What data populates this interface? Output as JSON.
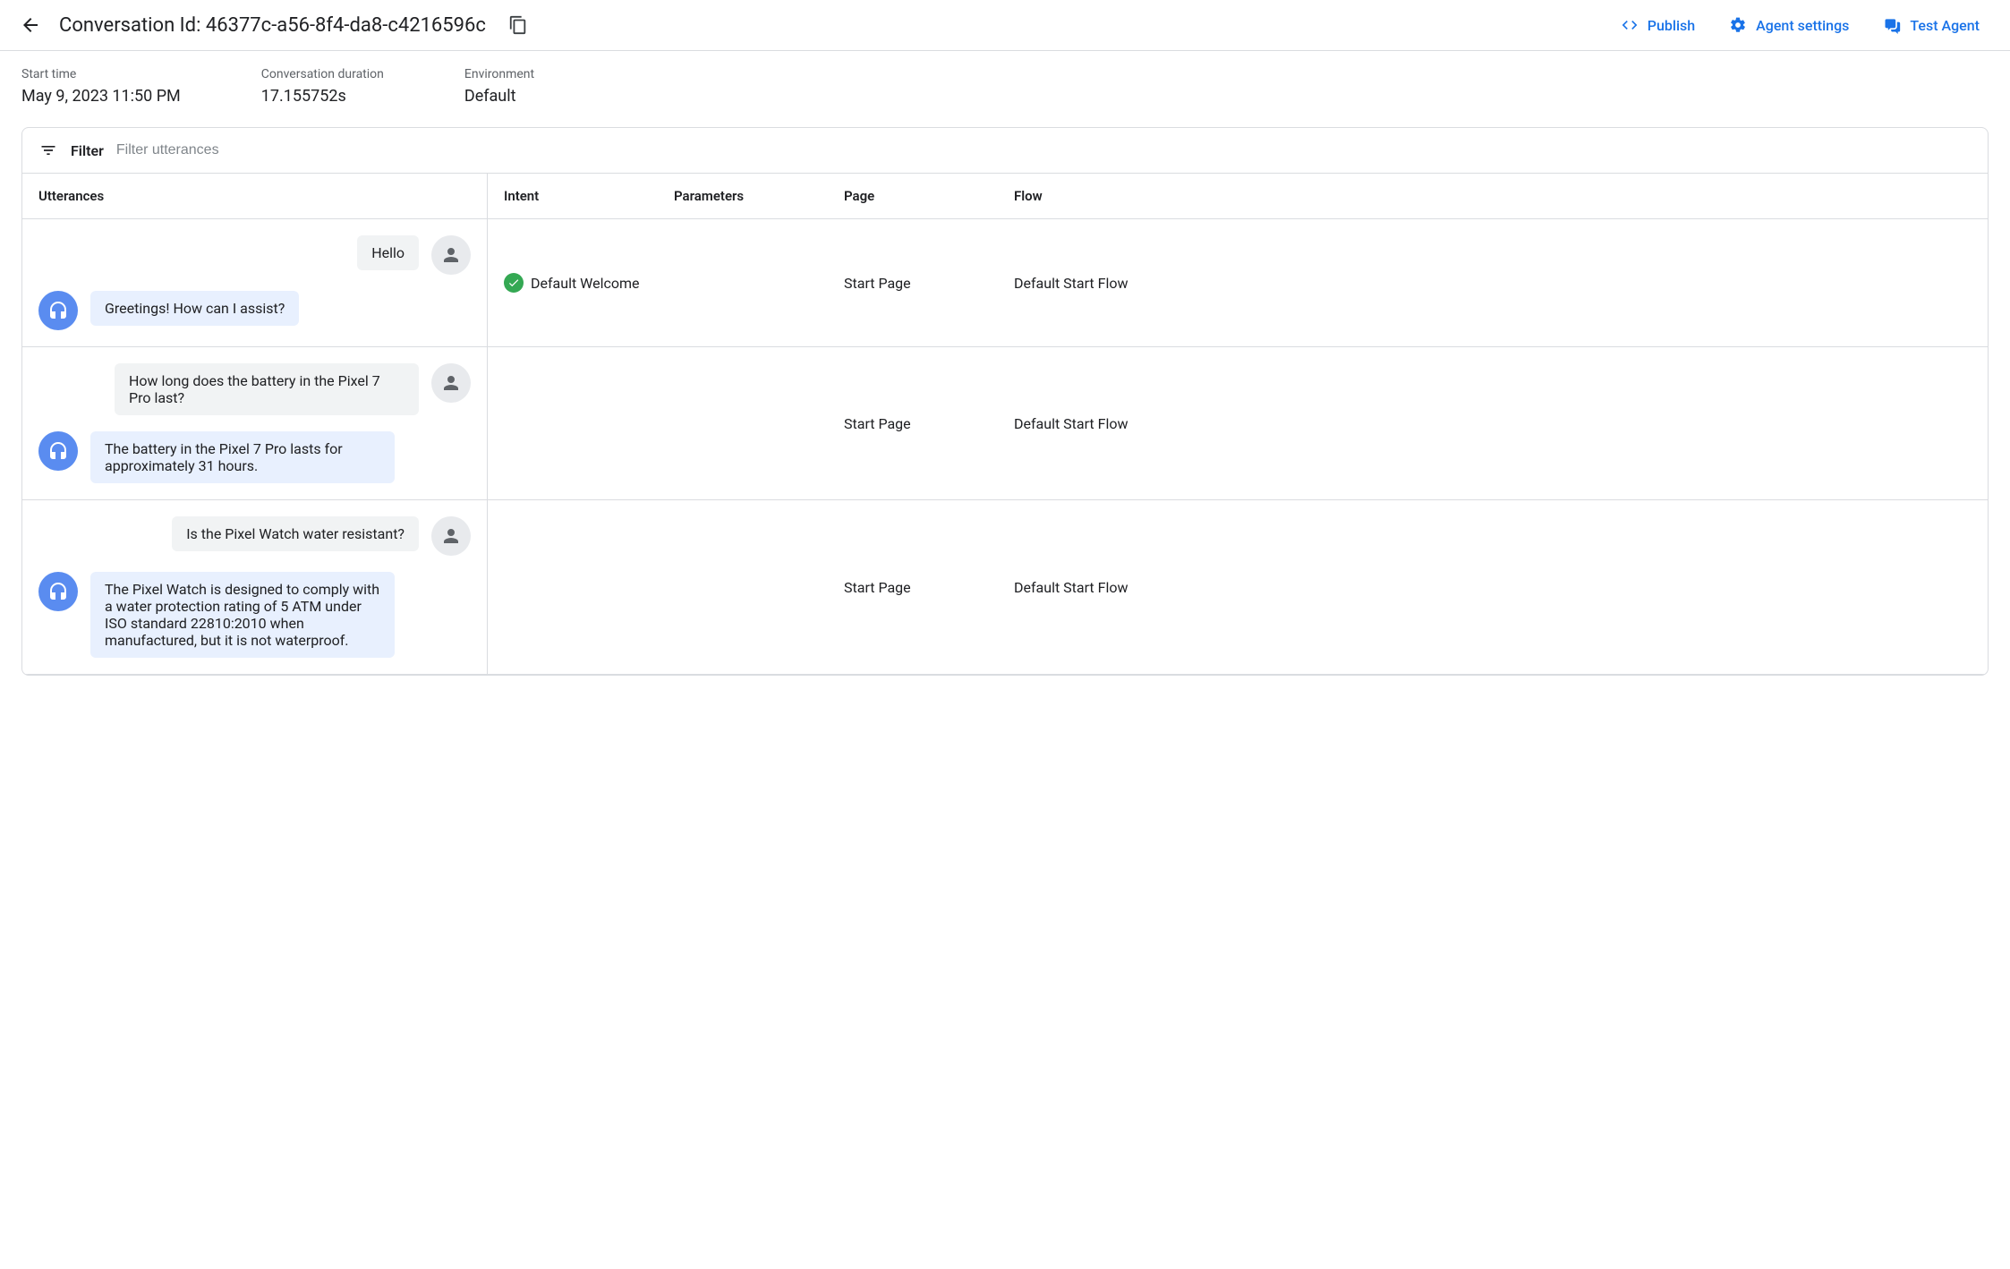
{
  "header": {
    "title": "Conversation Id: 46377c-a56-8f4-da8-c4216596c",
    "publish_label": "Publish",
    "agent_settings_label": "Agent settings",
    "test_agent_label": "Test Agent"
  },
  "meta": {
    "start_time_label": "Start time",
    "start_time_value": "May 9, 2023 11:50 PM",
    "duration_label": "Conversation duration",
    "duration_value": "17.155752s",
    "environment_label": "Environment",
    "environment_value": "Default"
  },
  "filter": {
    "label": "Filter",
    "placeholder": "Filter utterances"
  },
  "columns": {
    "utterances": "Utterances",
    "intent": "Intent",
    "parameters": "Parameters",
    "page": "Page",
    "flow": "Flow"
  },
  "turns": [
    {
      "user": "Hello",
      "agent": "Greetings! How can I assist?",
      "intent": "Default Welcome",
      "intent_has_check": true,
      "parameters": "",
      "page": "Start Page",
      "flow": "Default Start Flow"
    },
    {
      "user": "How long does the battery in the Pixel 7 Pro last?",
      "agent": "The battery in the Pixel 7 Pro lasts for approximately 31 hours.",
      "intent": "",
      "intent_has_check": false,
      "parameters": "",
      "page": "Start Page",
      "flow": "Default Start Flow"
    },
    {
      "user": "Is the Pixel Watch water resistant?",
      "agent": "The Pixel Watch is designed to comply with a water protection rating of 5 ATM under ISO standard 22810:2010 when manufactured, but it is not waterproof.",
      "intent": "",
      "intent_has_check": false,
      "parameters": "",
      "page": "Start Page",
      "flow": "Default Start Flow"
    }
  ]
}
